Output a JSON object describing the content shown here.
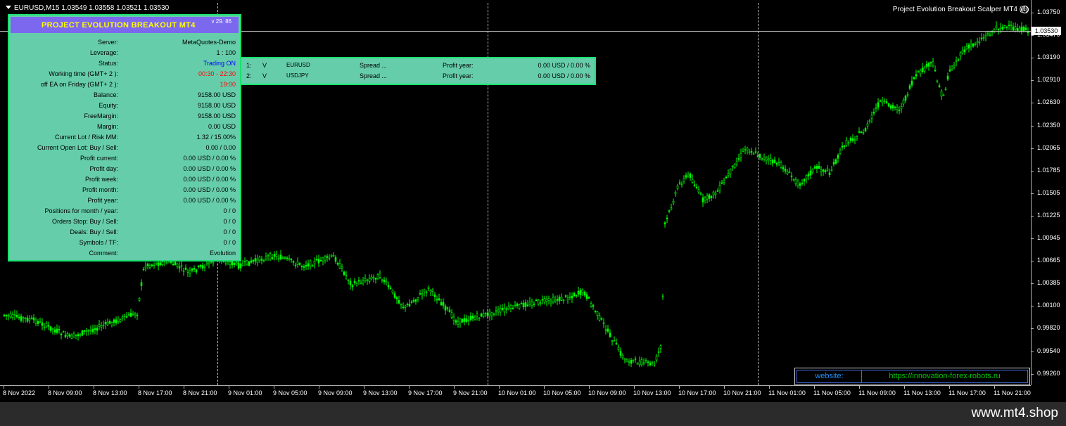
{
  "chart": {
    "symbol_line": "EURUSD,M15  1.03549 1.03558 1.03521 1.03530",
    "ea_title": "Project Evolution Breakout Scalper MT4 (4)",
    "current_price": "1.03530",
    "price_labels": [
      "1.03750",
      "1.03470",
      "1.03190",
      "1.02910",
      "1.02630",
      "1.02350",
      "1.02065",
      "1.01785",
      "1.01505",
      "1.01225",
      "1.00945",
      "1.00665",
      "1.00385",
      "1.00100",
      "0.99820",
      "0.99540",
      "0.99260"
    ],
    "time_labels": [
      "8 Nov 2022",
      "8 Nov 09:00",
      "8 Nov 13:00",
      "8 Nov 17:00",
      "8 Nov 21:00",
      "9 Nov 01:00",
      "9 Nov 05:00",
      "9 Nov 09:00",
      "9 Nov 13:00",
      "9 Nov 17:00",
      "9 Nov 21:00",
      "10 Nov 01:00",
      "10 Nov 05:00",
      "10 Nov 09:00",
      "10 Nov 13:00",
      "10 Nov 17:00",
      "10 Nov 21:00",
      "11 Nov 01:00",
      "11 Nov 05:00",
      "11 Nov 09:00",
      "11 Nov 13:00",
      "11 Nov 17:00",
      "11 Nov 21:00"
    ],
    "candle_color": "#00ff00",
    "background_color": "#000000"
  },
  "info_panel": {
    "title": "PROJECT EVOLUTION BREAKOUT MT4",
    "version": "v 29. 86",
    "rows": [
      {
        "label": "Server:",
        "value": "MetaQuotes-Demo",
        "color": "black"
      },
      {
        "label": "Leverage:",
        "value": "1 : 100",
        "color": "black"
      },
      {
        "label": "Status:",
        "value": "Trading ON",
        "color": "blue"
      },
      {
        "label": "Working time (GMT+ 2 ):",
        "value": "00:30 - 22:30",
        "color": "red"
      },
      {
        "label": "off EA on Friday (GMT+ 2 ):",
        "value": "19:00",
        "color": "red"
      },
      {
        "label": "Balance:",
        "value": "9158.00 USD",
        "color": "black"
      },
      {
        "label": "Equity:",
        "value": "9158.00 USD",
        "color": "black"
      },
      {
        "label": "FreeMargin:",
        "value": "9158.00 USD",
        "color": "black"
      },
      {
        "label": "Margin:",
        "value": "0.00 USD",
        "color": "black"
      },
      {
        "label": "Current Lot / Risk MM:",
        "value": "1.32 / 15.00%",
        "color": "black"
      },
      {
        "label": "Current Open Lot: Buy / Sell:",
        "value": "0.00  /  0.00",
        "color": "black"
      },
      {
        "label": "Profit current:",
        "value": "0.00 USD / 0.00 %",
        "color": "black"
      },
      {
        "label": "Profit day:",
        "value": "0.00 USD / 0.00 %",
        "color": "black"
      },
      {
        "label": "Profit week:",
        "value": "0.00 USD / 0.00 %",
        "color": "black"
      },
      {
        "label": "Profit month:",
        "value": "0.00 USD / 0.00 %",
        "color": "black"
      },
      {
        "label": "Profit year:",
        "value": "0.00 USD / 0.00 %",
        "color": "black"
      },
      {
        "label": "Positions for month / year:",
        "value": "0  /  0",
        "color": "black"
      },
      {
        "label": "Orders Stop: Buy / Sell:",
        "value": "0  /  0",
        "color": "black"
      },
      {
        "label": "Deals: Buy / Sell:",
        "value": "0  /  0",
        "color": "black"
      },
      {
        "label": "Symbols / TF:",
        "value": "0  /  0",
        "color": "black"
      },
      {
        "label": "Comment:",
        "value": "Evolution",
        "color": "black"
      }
    ]
  },
  "symbols_panel": {
    "rows": [
      {
        "index": "1:",
        "flag": "V",
        "symbol": "EURUSD",
        "spread": "Spread ...",
        "profit_label": "Profit year:",
        "profit_value": "0.00 USD / 0.00 %"
      },
      {
        "index": "2:",
        "flag": "V",
        "symbol": "USDJPY",
        "spread": "Spread ...",
        "profit_label": "Profit year:",
        "profit_value": "0.00 USD / 0.00 %"
      }
    ]
  },
  "website": {
    "label": "website:",
    "url": "https://innovation-forex-robots.ru"
  },
  "footer": {
    "text": "www.mt4.shop"
  },
  "colors": {
    "panel_bg": "#66cdaa",
    "panel_border": "#18e26e",
    "panel_header": "#7b68ee",
    "panel_title": "#ffff00"
  }
}
